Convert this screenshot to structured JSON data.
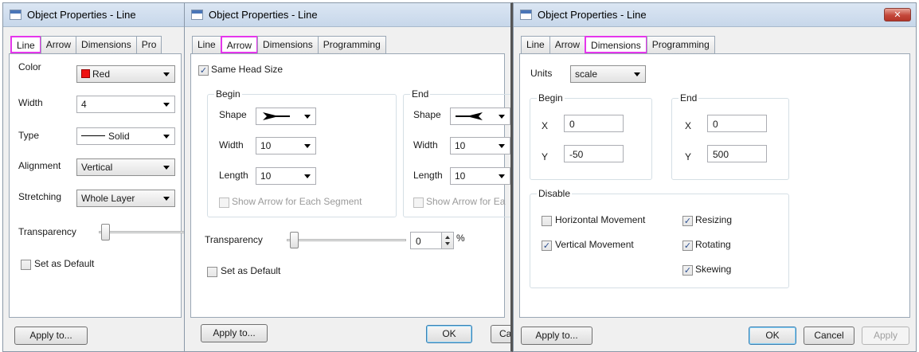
{
  "window1": {
    "title": "Object Properties - Line",
    "tabs": [
      "Line",
      "Arrow",
      "Dimensions",
      "Pro"
    ],
    "color_label": "Color",
    "color_value": "Red",
    "width_label": "Width",
    "width_value": "4",
    "type_label": "Type",
    "type_value": "Solid",
    "alignment_label": "Alignment",
    "alignment_value": "Vertical",
    "stretching_label": "Stretching",
    "stretching_value": "Whole Layer",
    "transparency_label": "Transparency",
    "set_default_label": "Set as Default",
    "apply_to_label": "Apply to..."
  },
  "window2": {
    "title": "Object Properties - Line",
    "tabs": [
      "Line",
      "Arrow",
      "Dimensions",
      "Programming"
    ],
    "same_head_label": "Same Head Size",
    "begin_title": "Begin",
    "end_title": "End",
    "shape_label": "Shape",
    "width_label": "Width",
    "length_label": "Length",
    "begin_width": "10",
    "begin_length": "10",
    "end_width": "10",
    "end_length": "10",
    "show_arrow_begin": "Show Arrow for Each Segment",
    "show_arrow_end": "Show Arrow for Ea",
    "transparency_label": "Transparency",
    "transparency_value": "0",
    "percent": "%",
    "set_default_label": "Set as Default",
    "apply_to_label": "Apply to...",
    "ok_label": "OK",
    "cancel_label": "Can"
  },
  "window3": {
    "title": "Object Properties - Line",
    "close_glyph": "✕",
    "tabs": [
      "Line",
      "Arrow",
      "Dimensions",
      "Programming"
    ],
    "units_label": "Units",
    "units_value": "scale",
    "begin_title": "Begin",
    "end_title": "End",
    "x_label": "X",
    "y_label": "Y",
    "begin_x": "0",
    "begin_y": "-50",
    "end_x": "0",
    "end_y": "500",
    "disable_title": "Disable",
    "horizontal_movement": "Horizontal Movement",
    "vertical_movement": "Vertical Movement",
    "resizing": "Resizing",
    "rotating": "Rotating",
    "skewing": "Skewing",
    "apply_to_label": "Apply to...",
    "ok_label": "OK",
    "cancel_label": "Cancel",
    "apply_label": "Apply"
  },
  "check_glyph": "✓",
  "colors": {
    "highlight": "#e536ec",
    "line_color": "#ee1111"
  }
}
